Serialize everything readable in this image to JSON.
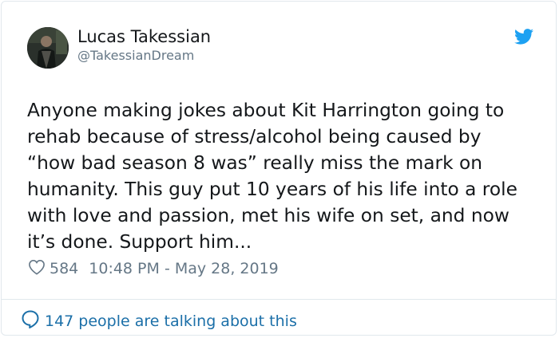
{
  "tweet": {
    "author": {
      "name": "Lucas Takessian",
      "handle": "@TakessianDream"
    },
    "text_lines": [
      "Anyone making jokes about Kit Harrington going to",
      "rehab because of stress/alcohol being caused by",
      "“how bad season 8 was” really miss the mark on",
      "humanity. This guy put 10 years of his life into a role",
      "with love and passion, met his wife on set, and now",
      "it’s done. Support him..."
    ],
    "likes": "584",
    "timestamp": "10:48 PM - May 28, 2019",
    "conversation": "147 people are talking about this"
  },
  "icons": {
    "brand": "twitter-bird-icon",
    "like": "heart-icon",
    "reply": "speech-bubble-icon"
  },
  "colors": {
    "text": "#14171a",
    "secondary": "#657786",
    "brand": "#1da1f2",
    "link": "#1b6fa8",
    "border": "#e1e8ed"
  }
}
